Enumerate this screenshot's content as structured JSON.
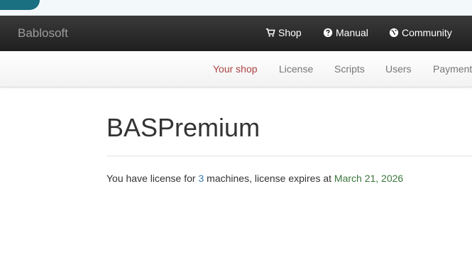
{
  "navbar": {
    "brand": "Bablosoft",
    "items": [
      {
        "label": "Shop",
        "icon": "cart-icon"
      },
      {
        "label": "Manual",
        "icon": "question-circle-icon"
      },
      {
        "label": "Community",
        "icon": "globe-icon"
      }
    ]
  },
  "subnav": {
    "items": [
      {
        "label": "Your shop",
        "active": true
      },
      {
        "label": "License"
      },
      {
        "label": "Scripts"
      },
      {
        "label": "Users"
      },
      {
        "label": "Payment"
      }
    ]
  },
  "main": {
    "title": "BASPremium",
    "license_prefix": "You have license for ",
    "machine_count": "3",
    "license_middle": " machines, license expires at ",
    "expiry_date": "March 21, 2026"
  },
  "colors": {
    "navbar_bg": "#222222",
    "active_tab": "#a94442",
    "count": "#337ab7",
    "date": "#3c763d"
  }
}
